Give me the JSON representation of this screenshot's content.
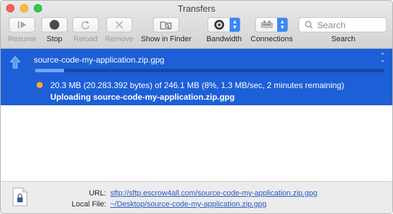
{
  "window": {
    "title": "Transfers"
  },
  "toolbar": {
    "resume_label": "Resume",
    "stop_label": "Stop",
    "reload_label": "Reload",
    "remove_label": "Remove",
    "show_in_finder_label": "Show in Finder",
    "bandwidth_label": "Bandwidth",
    "connections_label": "Connections",
    "search_label": "Search",
    "search_placeholder": "Search"
  },
  "transfer": {
    "filename": "source-code-my-application.zip.gpg",
    "progress_fraction": 0.083,
    "detail": "20.3 MB (20.283.392 bytes) of 246.1 MB (8%, 1.3 MB/sec, 2 minutes remaining)",
    "status": "Uploading source-code-my-application.zip.gpg",
    "status_color": "#f7ab2c",
    "selection_color": "#1d5fd6"
  },
  "info": {
    "url_label": "URL:",
    "url_value": "sftp://sftp.escrow4all.com/source-code-my-application.zip.gpg",
    "local_file_label": "Local File:",
    "local_file_value": "~/Desktop/source-code-my-application.zip.gpg"
  }
}
